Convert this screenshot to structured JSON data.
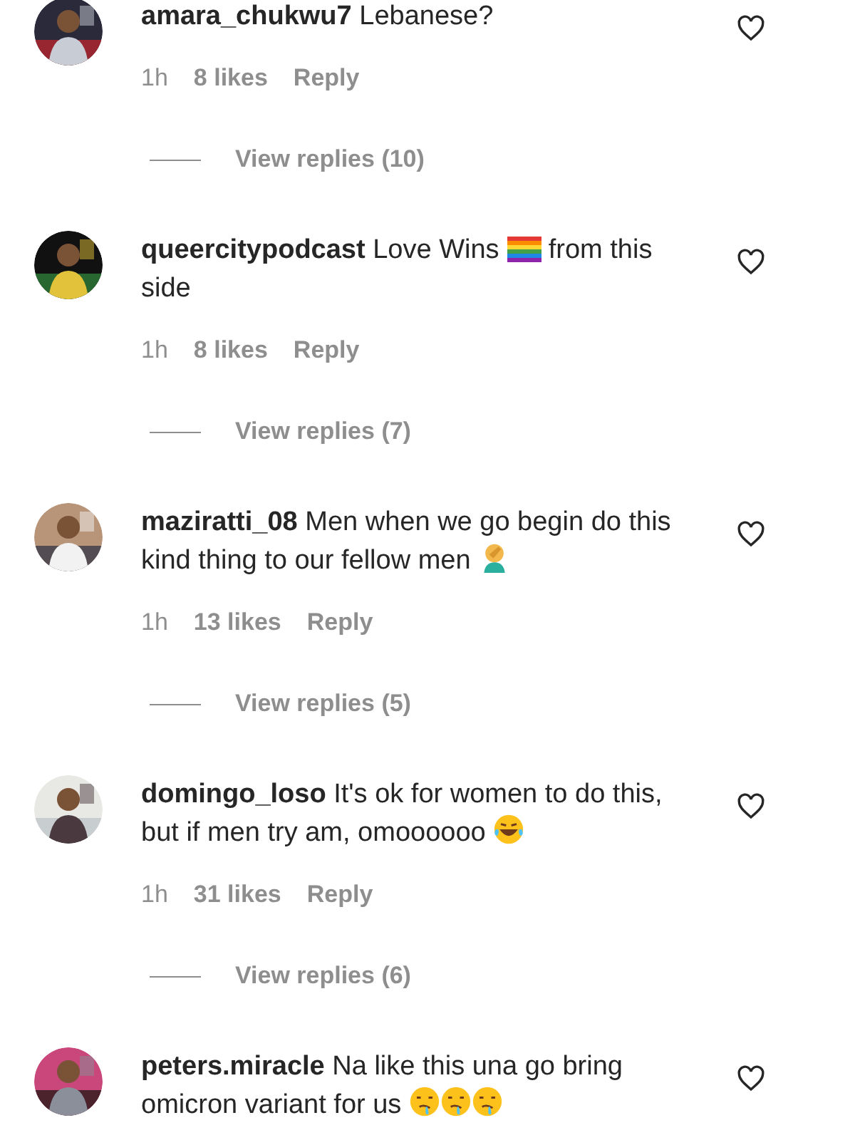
{
  "comments": [
    {
      "username": "amara_chukwu7",
      "body": [
        {
          "kind": "text",
          "text": "Lebanese?"
        }
      ],
      "liked": false,
      "time": "1h",
      "likes": "8 likes",
      "reply": "Reply",
      "view_replies": "View replies (10)"
    },
    {
      "username": "queercitypodcast",
      "body": [
        {
          "kind": "text",
          "text": "Love Wins"
        },
        {
          "kind": "flag"
        },
        {
          "kind": "text",
          "text": "from this side"
        }
      ],
      "liked": false,
      "time": "1h",
      "likes": "8 likes",
      "reply": "Reply",
      "view_replies": "View replies (7)"
    },
    {
      "username": "maziratti_08",
      "body": [
        {
          "kind": "text",
          "text": "Men when we go begin do this kind thing to our fellow men"
        },
        {
          "kind": "facepalm"
        }
      ],
      "liked": false,
      "time": "1h",
      "likes": "13 likes",
      "reply": "Reply",
      "view_replies": "View replies (5)"
    },
    {
      "username": "domingo_loso",
      "body": [
        {
          "kind": "text",
          "text": "It's ok for women to do this, but if men try am, omoooooo"
        },
        {
          "kind": "laughing"
        }
      ],
      "liked": false,
      "time": "1h",
      "likes": "31 likes",
      "reply": "Reply",
      "view_replies": "View replies (6)"
    },
    {
      "username": "peters.miracle",
      "body": [
        {
          "kind": "text",
          "text": "Na like this una go bring omicron variant for us"
        },
        {
          "kind": "drooling"
        },
        {
          "kind": "drooling"
        },
        {
          "kind": "drooling"
        }
      ],
      "liked": false
    }
  ]
}
